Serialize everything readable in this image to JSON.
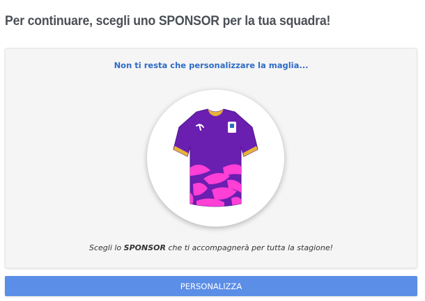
{
  "header": {
    "title": "Per continuare, scegli uno SPONSOR per la tua squadra!"
  },
  "card": {
    "heading": "Non ti resta che personalizzare la maglia...",
    "caption_prefix": "Scegli lo ",
    "caption_bold": "SPONSOR",
    "caption_suffix": " che ti accompagnerà per tutta la stagione!"
  },
  "jersey": {
    "icon": "jersey-icon",
    "colors": {
      "body": "#6a1fb0",
      "collar": "#e8b23a",
      "pattern": "#ff3fd6"
    }
  },
  "actions": {
    "personalize_label": "PERSONALIZZA"
  },
  "colors": {
    "accent_button": "#5b8ee6",
    "heading_blue": "#2e6bc6"
  }
}
